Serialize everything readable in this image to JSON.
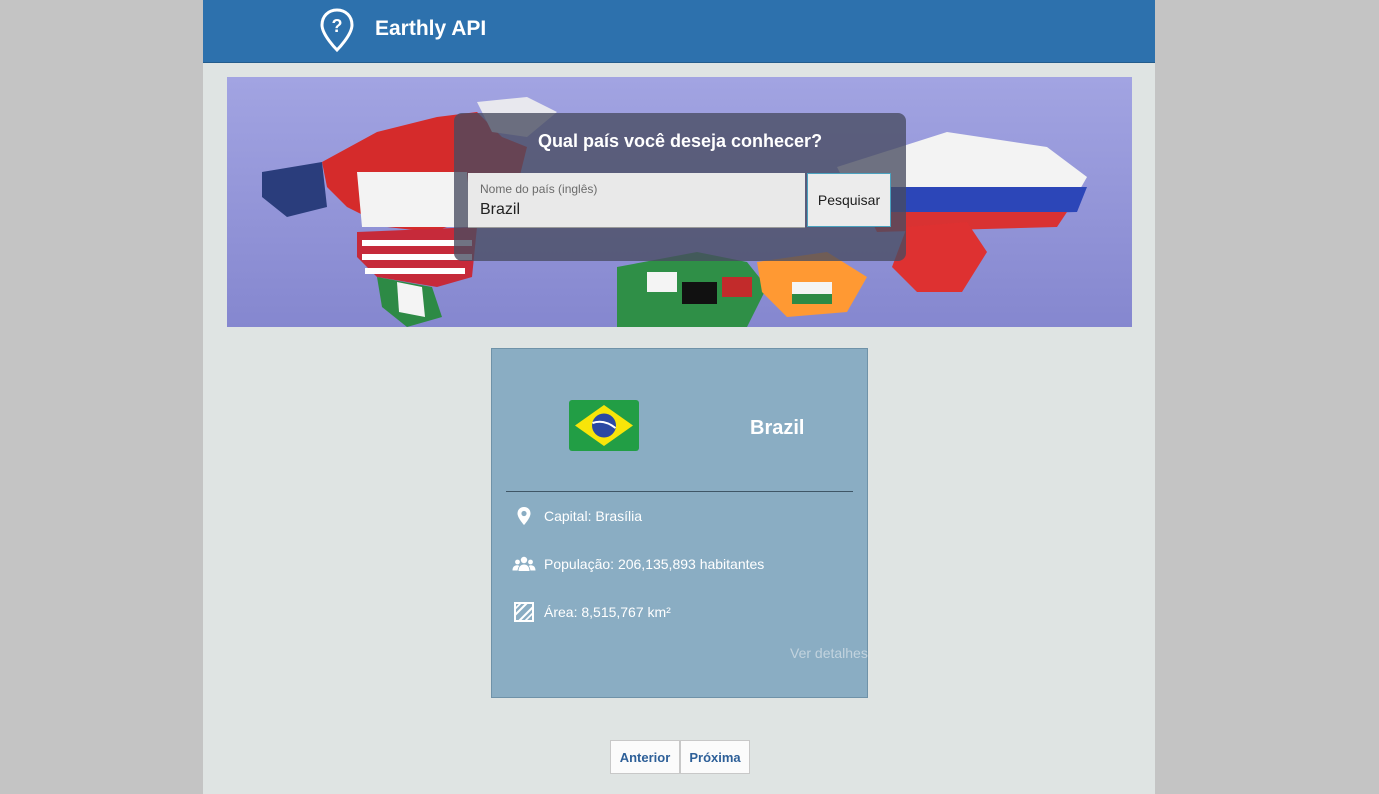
{
  "header": {
    "app_title": "Earthly API",
    "logo_icon": "map-pin-question-icon"
  },
  "search": {
    "title": "Qual país você deseja conhecer?",
    "field_label": "Nome do país (inglês)",
    "value": "Brazil",
    "button_label": "Pesquisar"
  },
  "country_card": {
    "name": "Brazil",
    "flag_icon": "brazil-flag-icon",
    "capital": "Capital: Brasília",
    "population": "População: 206,135,893 habitantes",
    "area": "Área: 8,515,767 km²",
    "details_link": "Ver detalhes"
  },
  "pagination": {
    "previous_label": "Anterior",
    "next_label": "Próxima"
  },
  "colors": {
    "header_bg": "#2d71ad",
    "card_bg": "#8aadc3",
    "page_bg": "#dfe4e3",
    "pager_text": "#2d5f98"
  }
}
